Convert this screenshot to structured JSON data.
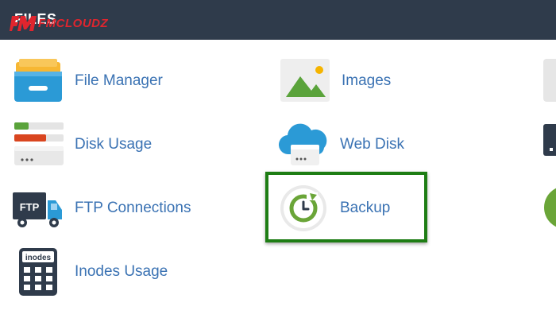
{
  "header": {
    "title": "FILES",
    "logo_text": "FMCLOUDZ"
  },
  "items": {
    "file_manager": "File Manager",
    "images": "Images",
    "disk_usage": "Disk Usage",
    "web_disk": "Web Disk",
    "ftp_connections": "FTP Connections",
    "backup": "Backup",
    "inodes_usage": "Inodes Usage"
  },
  "icon_text": {
    "ftp": "FTP",
    "inodes": "inodes"
  },
  "colors": {
    "header_bg": "#2f3b4b",
    "link": "#3a72b3",
    "highlight_border": "#1e7d14",
    "logo_red": "#e0252e"
  }
}
